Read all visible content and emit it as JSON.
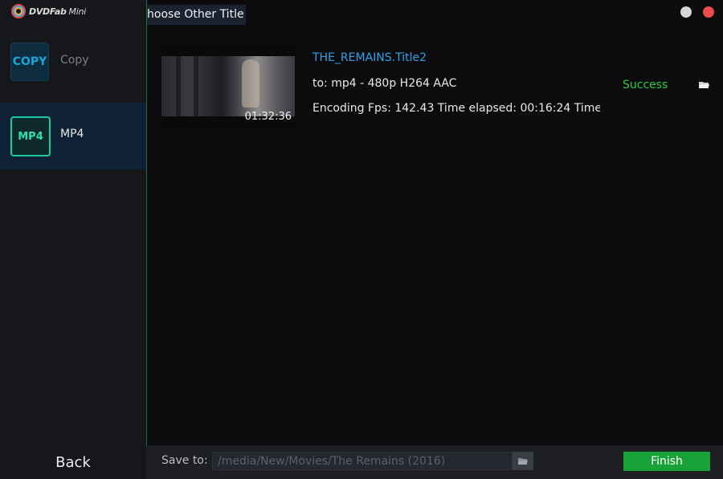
{
  "app": {
    "logo_brand": "DVDFab",
    "logo_suffix": "Mini"
  },
  "titlebar": {
    "choose_title": "hoose Other Title"
  },
  "sidebar": {
    "items": [
      {
        "icon_text": "COPY",
        "label": "Copy",
        "selected": false
      },
      {
        "icon_text": "MP4",
        "label": "MP4",
        "selected": true
      }
    ],
    "back_label": "Back"
  },
  "task": {
    "thumbnail_duration": "01:32:36",
    "title": "THE_REMAINS.Title2",
    "format": "to: mp4 - 480p H264 AAC",
    "progress": "Encoding Fps: 142.43  Time elapsed: 00:16:24  Time",
    "status": "Success"
  },
  "bottom": {
    "save_label": "Save to:",
    "save_path": "/media/New/Movies/The Remains (2016)",
    "finish_label": "Finish"
  },
  "colors": {
    "accent_blue": "#2aa3e8",
    "success_green": "#2ecc40",
    "finish_green": "#1aa23a",
    "mp4_teal": "#1fc9a0"
  }
}
